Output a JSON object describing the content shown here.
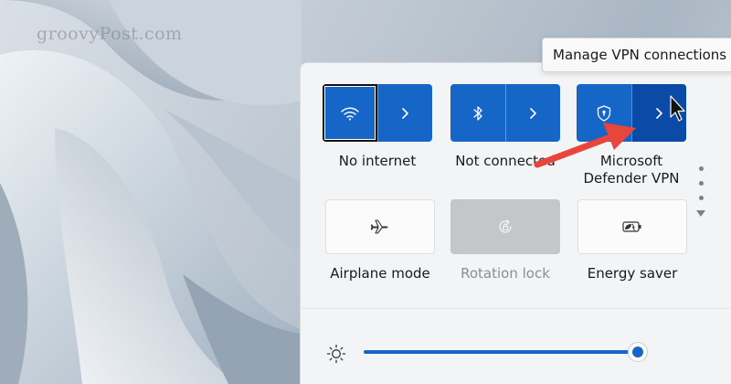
{
  "watermark": "groovyPost.com",
  "tooltip": {
    "text": "Manage VPN connections"
  },
  "tiles": {
    "wifi": {
      "label": "No internet",
      "icon": "wifi-icon",
      "chevron_icon": "chevron-right-icon"
    },
    "bluetooth": {
      "label": "Not connected",
      "icon": "bluetooth-icon",
      "chevron_icon": "chevron-right-icon"
    },
    "vpn": {
      "label_line1": "Microsoft",
      "label_line2": "Defender VPN",
      "icon": "shield-lock-icon",
      "chevron_icon": "chevron-right-icon"
    },
    "airplane": {
      "label": "Airplane mode",
      "icon": "airplane-icon"
    },
    "rotation": {
      "label": "Rotation lock",
      "icon": "rotation-lock-icon",
      "disabled": true
    },
    "energy": {
      "label": "Energy saver",
      "icon": "energy-saver-icon"
    }
  },
  "brightness": {
    "icon": "brightness-icon",
    "level": 1.0
  },
  "colors": {
    "accent": "#1566c7",
    "accent_hover": "#0b4aa6",
    "annotation_arrow": "#e8453c"
  }
}
